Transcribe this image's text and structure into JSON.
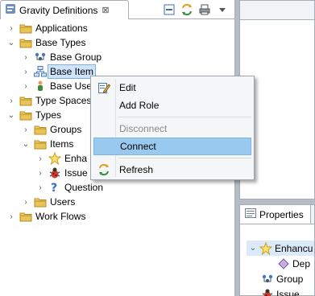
{
  "view": {
    "title": "Gravity Definitions",
    "close_glyph": "⊠"
  },
  "toolbar": {
    "icons": [
      "collapse-all-icon",
      "sync-icon",
      "print-icon",
      "view-menu-icon"
    ]
  },
  "tree": {
    "items": [
      {
        "label": "Applications",
        "indent": 0,
        "twisty": "›",
        "icon": "folder-icon"
      },
      {
        "label": "Base Types",
        "indent": 0,
        "twisty": "⌄",
        "icon": "folder-icon"
      },
      {
        "label": "Base Group",
        "indent": 1,
        "twisty": "›",
        "icon": "group-icon"
      },
      {
        "label": "Base Item",
        "indent": 1,
        "twisty": "›",
        "icon": "item-icon"
      },
      {
        "label": "Base Use",
        "indent": 1,
        "twisty": "›",
        "icon": "user-icon"
      },
      {
        "label": "Type Spaces",
        "indent": 0,
        "twisty": "›",
        "icon": "folder-icon"
      },
      {
        "label": "Types",
        "indent": 0,
        "twisty": "⌄",
        "icon": "folder-icon"
      },
      {
        "label": "Groups",
        "indent": 1,
        "twisty": "›",
        "icon": "folder-icon"
      },
      {
        "label": "Items",
        "indent": 1,
        "twisty": "⌄",
        "icon": "folder-icon"
      },
      {
        "label": "Enha",
        "indent": 2,
        "twisty": "›",
        "icon": "star-icon"
      },
      {
        "label": "Issue",
        "indent": 2,
        "twisty": "›",
        "icon": "bug-icon"
      },
      {
        "label": "Question",
        "indent": 2,
        "twisty": "›",
        "icon": "question-icon"
      },
      {
        "label": "Users",
        "indent": 1,
        "twisty": "›",
        "icon": "folder-icon"
      },
      {
        "label": "Work Flows",
        "indent": 0,
        "twisty": "›",
        "icon": "folder-icon"
      }
    ]
  },
  "context_menu": {
    "items": [
      {
        "label": "Edit",
        "icon": "edit-icon",
        "enabled": true
      },
      {
        "label": "Add Role",
        "icon": "",
        "enabled": true
      },
      {
        "label": "Disconnect",
        "icon": "",
        "enabled": false
      },
      {
        "label": "Connect",
        "icon": "",
        "enabled": true,
        "highlighted": true
      },
      {
        "label": "Refresh",
        "icon": "refresh-icon",
        "enabled": true
      }
    ]
  },
  "properties": {
    "tab_label": "Properties",
    "rows": [
      {
        "label": "Enhancu",
        "twisty": "⌄",
        "icon": "star-icon"
      },
      {
        "label": "Dep",
        "twisty": "",
        "icon": "diamond-icon"
      },
      {
        "label": "Group",
        "twisty": "",
        "icon": "group-icon"
      },
      {
        "label": "Issue",
        "twisty": "",
        "icon": "bug-icon"
      }
    ]
  },
  "colors": {
    "selection": "#cfe4fa",
    "menu_highlight": "#99c9ef",
    "folder": "#e8c35a"
  }
}
